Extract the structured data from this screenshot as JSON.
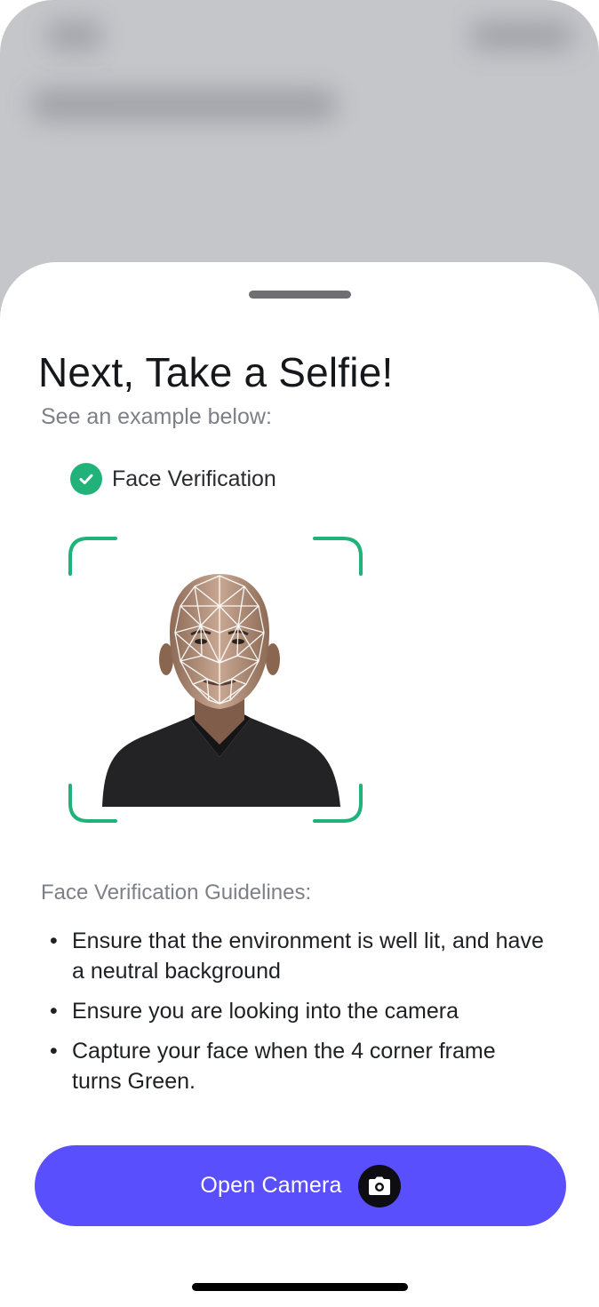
{
  "sheet": {
    "title": "Next, Take a Selfie!",
    "subtitle": "See an example below:"
  },
  "verification": {
    "label": "Face Verification",
    "status_color": "#21B27A"
  },
  "guidelines": {
    "heading": "Face Verification Guidelines:",
    "bullet": "•",
    "items": [
      {
        "text": "Ensure that the environment is well lit, and have a neutral background"
      },
      {
        "text": "Ensure you are looking into the camera"
      },
      {
        "text": "Capture your face when the 4 corner frame turns Green."
      }
    ]
  },
  "actions": {
    "open_camera_label": "Open Camera",
    "open_camera_icon": "camera-icon",
    "button_color": "#5A4FFC"
  },
  "colors": {
    "frame_corner": "#21B27A",
    "backdrop": "#C5C6CA"
  }
}
